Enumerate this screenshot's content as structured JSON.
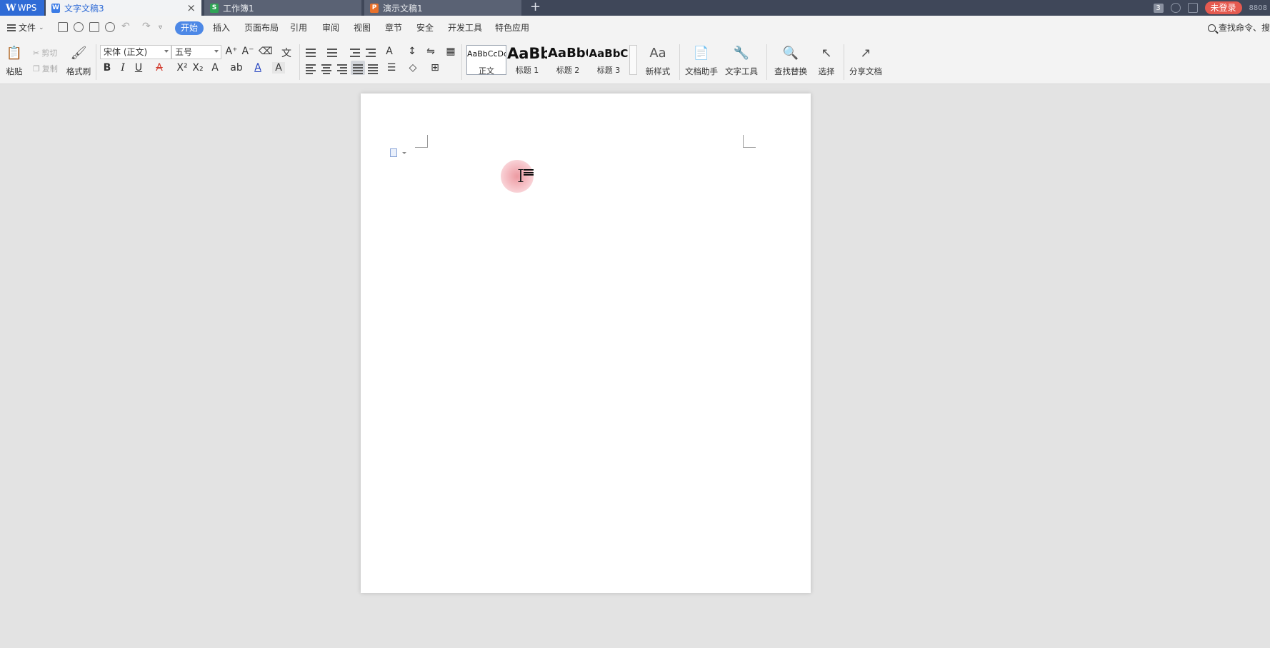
{
  "tabbar": {
    "wps_label": "WPS",
    "tabs": [
      {
        "label": "文字文稿3",
        "icon": "W"
      },
      {
        "label": "工作簿1",
        "icon": "S"
      },
      {
        "label": "演示文稿1",
        "icon": "P"
      }
    ],
    "window_count": "3",
    "login_label": "未登录",
    "user_id": "8808"
  },
  "menubar": {
    "file_label": "文件",
    "tabs": [
      "开始",
      "插入",
      "页面布局",
      "引用",
      "审阅",
      "视图",
      "章节",
      "安全",
      "开发工具",
      "特色应用"
    ],
    "search_label": "查找命令、搜"
  },
  "ribbon": {
    "paste": "粘贴",
    "cut": "剪切",
    "copy": "复制",
    "format_painter": "格式刷",
    "font_name": "宋体 (正文)",
    "font_size": "五号",
    "styles": [
      {
        "preview": "AaBbCcDd",
        "label": "正文"
      },
      {
        "preview": "AaBb",
        "label": "标题 1"
      },
      {
        "preview": "AaBbC",
        "label": "标题 2"
      },
      {
        "preview": "AaBbC",
        "label": "标题 3"
      }
    ],
    "new_style": "新样式",
    "doc_assistant": "文档助手",
    "text_tools": "文字工具",
    "find_replace": "查找替换",
    "select": "选择",
    "share_doc": "分享文档",
    "font_color": "#1f3fbf",
    "strike_color": "#d23b2e"
  }
}
